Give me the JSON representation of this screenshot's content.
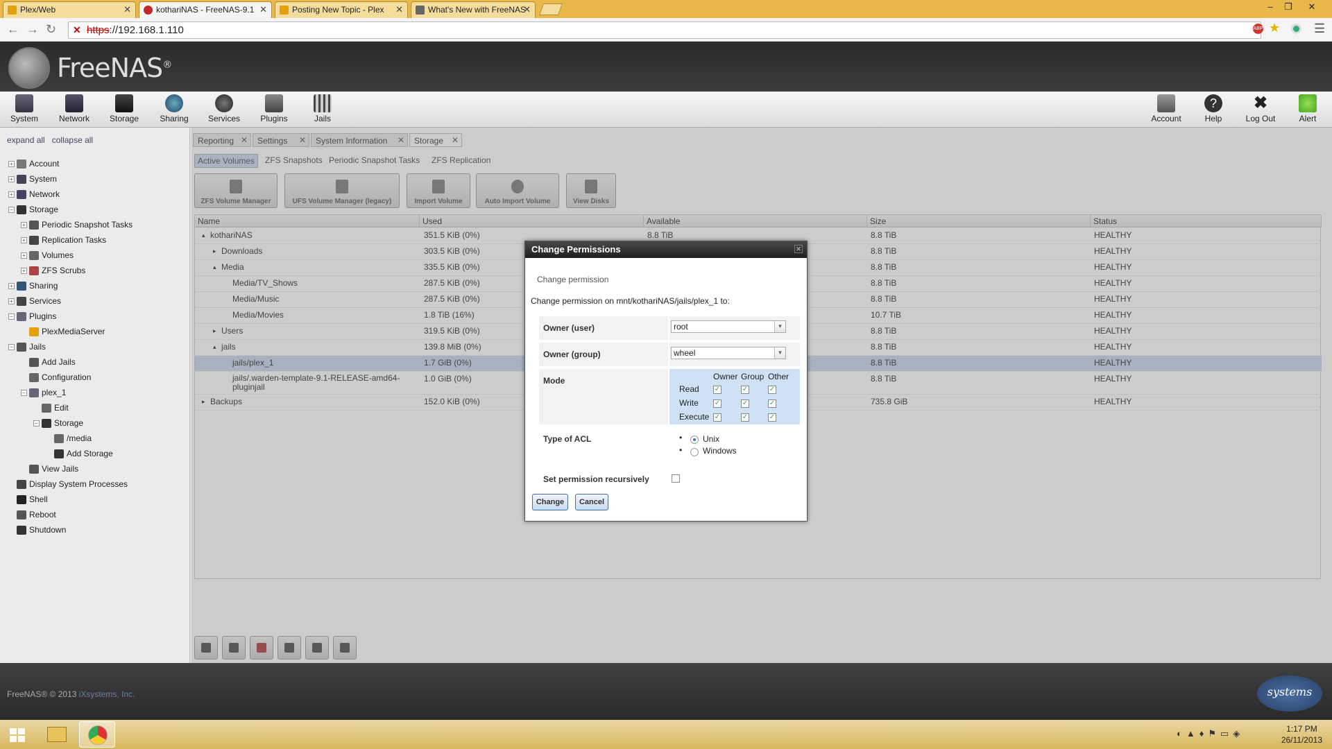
{
  "browser": {
    "tabs": [
      {
        "title": "Plex/Web",
        "favicon": "plex-icon",
        "active": false
      },
      {
        "title": "kothariNAS - FreeNAS-9.1",
        "favicon": "freenas-icon",
        "active": true
      },
      {
        "title": "Posting New Topic - Plex",
        "favicon": "plex-icon",
        "active": false
      },
      {
        "title": "What's New with FreeNAS",
        "favicon": "freenas-icon",
        "active": false
      }
    ],
    "url_scheme": "https",
    "url_rest": "://192.168.1.110"
  },
  "header": {
    "logo_text": "FreeNAS",
    "logo_mark": "®"
  },
  "toolbar": {
    "left": [
      "System",
      "Network",
      "Storage",
      "Sharing",
      "Services",
      "Plugins",
      "Jails"
    ],
    "right": [
      "Account",
      "Help",
      "Log Out",
      "Alert"
    ]
  },
  "sidebar": {
    "expand_all": "expand all",
    "collapse_all": "collapse all",
    "items": [
      {
        "label": "Account",
        "level": 0,
        "box": "+",
        "icon": "account-icon"
      },
      {
        "label": "System",
        "level": 0,
        "box": "+",
        "icon": "system-icon"
      },
      {
        "label": "Network",
        "level": 0,
        "box": "+",
        "icon": "network-icon"
      },
      {
        "label": "Storage",
        "level": 0,
        "box": "−",
        "icon": "storage-icon"
      },
      {
        "label": "Periodic Snapshot Tasks",
        "level": 1,
        "box": "+",
        "icon": "snapshot-icon"
      },
      {
        "label": "Replication Tasks",
        "level": 1,
        "box": "+",
        "icon": "replication-icon"
      },
      {
        "label": "Volumes",
        "level": 1,
        "box": "+",
        "icon": "volumes-icon"
      },
      {
        "label": "ZFS Scrubs",
        "level": 1,
        "box": "+",
        "icon": "scrub-icon"
      },
      {
        "label": "Sharing",
        "level": 0,
        "box": "+",
        "icon": "sharing-icon"
      },
      {
        "label": "Services",
        "level": 0,
        "box": "+",
        "icon": "services-icon"
      },
      {
        "label": "Plugins",
        "level": 0,
        "box": "−",
        "icon": "plugins-icon"
      },
      {
        "label": "PlexMediaServer",
        "level": 1,
        "box": "",
        "icon": "plex-icon"
      },
      {
        "label": "Jails",
        "level": 0,
        "box": "−",
        "icon": "jails-icon"
      },
      {
        "label": "Add Jails",
        "level": 1,
        "box": "",
        "icon": "jails-icon"
      },
      {
        "label": "Configuration",
        "level": 1,
        "box": "",
        "icon": "wrench-icon"
      },
      {
        "label": "plex_1",
        "level": 1,
        "box": "−",
        "icon": "plugins-icon"
      },
      {
        "label": "Edit",
        "level": 2,
        "box": "",
        "icon": "wrench-icon"
      },
      {
        "label": "Storage",
        "level": 2,
        "box": "−",
        "icon": "storage-icon"
      },
      {
        "label": "/media",
        "level": 3,
        "box": "",
        "icon": "wrench-icon"
      },
      {
        "label": "Add Storage",
        "level": 3,
        "box": "",
        "icon": "storage-icon"
      },
      {
        "label": "View Jails",
        "level": 1,
        "box": "",
        "icon": "jails-icon"
      },
      {
        "label": "Display System Processes",
        "level": 0,
        "box": "",
        "icon": "processes-icon"
      },
      {
        "label": "Shell",
        "level": 0,
        "box": "",
        "icon": "shell-icon"
      },
      {
        "label": "Reboot",
        "level": 0,
        "box": "",
        "icon": "reboot-icon"
      },
      {
        "label": "Shutdown",
        "level": 0,
        "box": "",
        "icon": "shutdown-icon"
      }
    ]
  },
  "content_tabs": [
    {
      "label": "Reporting",
      "active": false
    },
    {
      "label": "Settings",
      "active": false
    },
    {
      "label": "System Information",
      "active": false
    },
    {
      "label": "Storage",
      "active": true
    }
  ],
  "sub_tabs": [
    {
      "label": "Active Volumes",
      "active": true
    },
    {
      "label": "ZFS Snapshots",
      "active": false
    },
    {
      "label": "Periodic Snapshot Tasks",
      "active": false
    },
    {
      "label": "ZFS Replication",
      "active": false
    }
  ],
  "action_buttons": [
    "ZFS Volume Manager",
    "UFS Volume Manager (legacy)",
    "Import Volume",
    "Auto Import Volume",
    "View Disks"
  ],
  "grid": {
    "columns": [
      "Name",
      "Used",
      "Available",
      "Size",
      "Status"
    ],
    "rows": [
      {
        "name": "kothariNAS",
        "indent": 0,
        "toggle": "▴",
        "used": "351.5 KiB (0%)",
        "available": "8.8 TiB",
        "size": "8.8 TiB",
        "status": "HEALTHY",
        "selected": false
      },
      {
        "name": "Downloads",
        "indent": 1,
        "toggle": "▸",
        "used": "303.5 KiB (0%)",
        "available": "",
        "size": "8.8 TiB",
        "status": "HEALTHY",
        "selected": false
      },
      {
        "name": "Media",
        "indent": 1,
        "toggle": "▴",
        "used": "335.5 KiB (0%)",
        "available": "",
        "size": "8.8 TiB",
        "status": "HEALTHY",
        "selected": false
      },
      {
        "name": "Media/TV_Shows",
        "indent": 2,
        "toggle": "",
        "used": "287.5 KiB (0%)",
        "available": "",
        "size": "8.8 TiB",
        "status": "HEALTHY",
        "selected": false
      },
      {
        "name": "Media/Music",
        "indent": 2,
        "toggle": "",
        "used": "287.5 KiB (0%)",
        "available": "",
        "size": "8.8 TiB",
        "status": "HEALTHY",
        "selected": false
      },
      {
        "name": "Media/Movies",
        "indent": 2,
        "toggle": "",
        "used": "1.8 TiB (16%)",
        "available": "",
        "size": "10.7 TiB",
        "status": "HEALTHY",
        "selected": false
      },
      {
        "name": "Users",
        "indent": 1,
        "toggle": "▸",
        "used": "319.5 KiB (0%)",
        "available": "",
        "size": "8.8 TiB",
        "status": "HEALTHY",
        "selected": false
      },
      {
        "name": "jails",
        "indent": 1,
        "toggle": "▴",
        "used": "139.8 MiB (0%)",
        "available": "",
        "size": "8.8 TiB",
        "status": "HEALTHY",
        "selected": false
      },
      {
        "name": "jails/plex_1",
        "indent": 2,
        "toggle": "",
        "used": "1.7 GiB (0%)",
        "available": "",
        "size": "8.8 TiB",
        "status": "HEALTHY",
        "selected": true
      },
      {
        "name": "jails/.warden-template-9.1-RELEASE-amd64-pluginjail",
        "indent": 2,
        "toggle": "",
        "used": "1.0 GiB (0%)",
        "available": "",
        "size": "8.8 TiB",
        "status": "HEALTHY",
        "selected": false
      },
      {
        "name": "Backups",
        "indent": 0,
        "toggle": "▸",
        "used": "152.0 KiB (0%)",
        "available": "",
        "size": "735.8 GiB",
        "status": "HEALTHY",
        "selected": false
      }
    ]
  },
  "dialog": {
    "title": "Change Permissions",
    "subtitle": "Change permission",
    "description": "Change permission on mnt/kothariNAS/jails/plex_1 to:",
    "owner_user_label": "Owner (user)",
    "owner_user_value": "root",
    "owner_group_label": "Owner (group)",
    "owner_group_value": "wheel",
    "mode_label": "Mode",
    "mode_columns": [
      "Owner",
      "Group",
      "Other"
    ],
    "mode_rows": [
      "Read",
      "Write",
      "Execute"
    ],
    "mode_checked": [
      [
        true,
        true,
        true
      ],
      [
        true,
        true,
        true
      ],
      [
        true,
        true,
        true
      ]
    ],
    "acl_label": "Type of ACL",
    "acl_options": [
      "Unix",
      "Windows"
    ],
    "acl_selected": "Unix",
    "recursive_label": "Set permission recursively",
    "recursive_checked": false,
    "change_button": "Change",
    "cancel_button": "Cancel"
  },
  "footer": {
    "copyright": "FreeNAS® © 2013",
    "company": "iXsystems, Inc.",
    "logo_text": "systems"
  },
  "taskbar": {
    "time": "1:17 PM",
    "date": "26/11/2013"
  }
}
